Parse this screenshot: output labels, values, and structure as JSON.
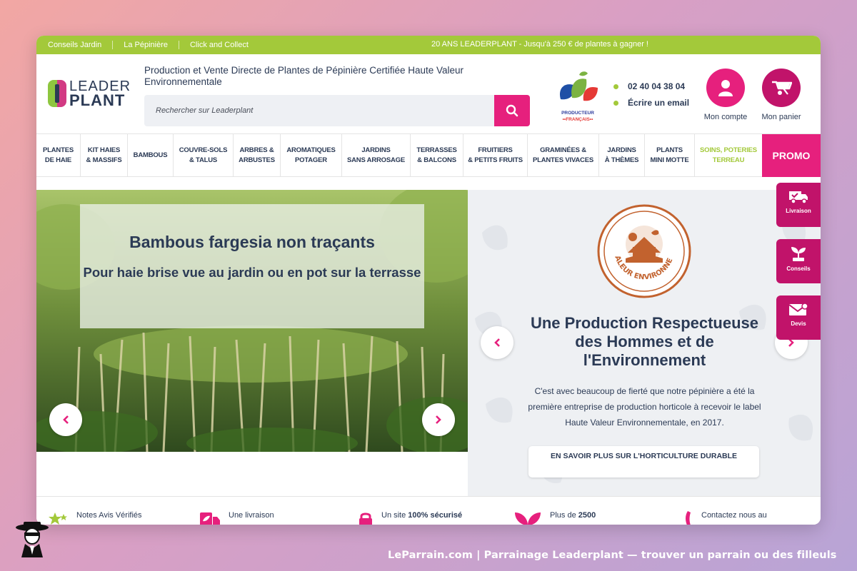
{
  "topbar": {
    "links": [
      "Conseils Jardin",
      "La Pépinière",
      "Click and Collect"
    ],
    "promo": "20 ANS LEADERPLANT - Jusqu'à 250 € de plantes à gagner !"
  },
  "header": {
    "logo_line1": "LEADER",
    "logo_line2": "PLANT",
    "tagline": "Production et Vente Directe de Plantes de Pépinière Certifiée Haute Valeur Environnementale",
    "search_placeholder": "Rechercher sur Leaderplant",
    "producteur_label_1": "PRODUCTEUR",
    "producteur_label_2": "••FRANÇAIS••",
    "phone": "02 40 04 38 04",
    "email_label": "Écrire un email",
    "account_label": "Mon compte",
    "cart_label": "Mon panier"
  },
  "nav": {
    "items": [
      {
        "l1": "PLANTES",
        "l2": "DE HAIE"
      },
      {
        "l1": "KIT HAIES",
        "l2": "& MASSIFS"
      },
      {
        "l1": "BAMBOUS",
        "l2": ""
      },
      {
        "l1": "COUVRE-SOLS",
        "l2": "& TALUS"
      },
      {
        "l1": "ARBRES &",
        "l2": "ARBUSTES"
      },
      {
        "l1": "AROMATIQUES",
        "l2": "POTAGER"
      },
      {
        "l1": "JARDINS",
        "l2": "SANS ARROSAGE"
      },
      {
        "l1": "TERRASSES",
        "l2": "& BALCONS"
      },
      {
        "l1": "FRUITIERS",
        "l2": "& PETITS FRUITS"
      },
      {
        "l1": "GRAMINÉES &",
        "l2": "PLANTES VIVACES"
      },
      {
        "l1": "JARDINS",
        "l2": "À THÈMES"
      },
      {
        "l1": "PLANTS",
        "l2": "MINI MOTTE"
      },
      {
        "l1": "SOINS, POTERIES",
        "l2": "TERREAU"
      }
    ],
    "promo": "PROMO"
  },
  "hero": {
    "title": "Bambous fargesia non traçants",
    "subtitle": "Pour haie brise vue au jardin ou en pot sur la terrasse"
  },
  "hve": {
    "badge_text": "HAUTE VALEUR ENVIRONNEMENTALE",
    "title": "Une Production Respectueuse des Hommes et de l'Environnement",
    "text": "C'est avec beaucoup de fierté que notre pépinière a été la première entreprise de production horticole à recevoir le label Haute Valeur Environnementale, en 2017.",
    "button": "EN SAVOIR PLUS SUR L'HORTICULTURE DURABLE"
  },
  "side_tabs": [
    "Livraison",
    "Conseils",
    "Devis"
  ],
  "bottom": {
    "reviews": "Notes Avis Vérifiés",
    "delivery": "Une livraison",
    "secure_prefix": "Un site ",
    "secure_bold": "100% sécurisé",
    "plants_prefix": "Plus de ",
    "plants_bold": "2500",
    "contact": "Contactez nous au"
  },
  "footer_credit": "LeParrain.com | Parrainage Leaderplant — trouver un parrain ou des filleuls",
  "colors": {
    "green": "#a3c93a",
    "pink": "#e6207d",
    "magenta": "#c1136a",
    "navy": "#2b3a55"
  }
}
